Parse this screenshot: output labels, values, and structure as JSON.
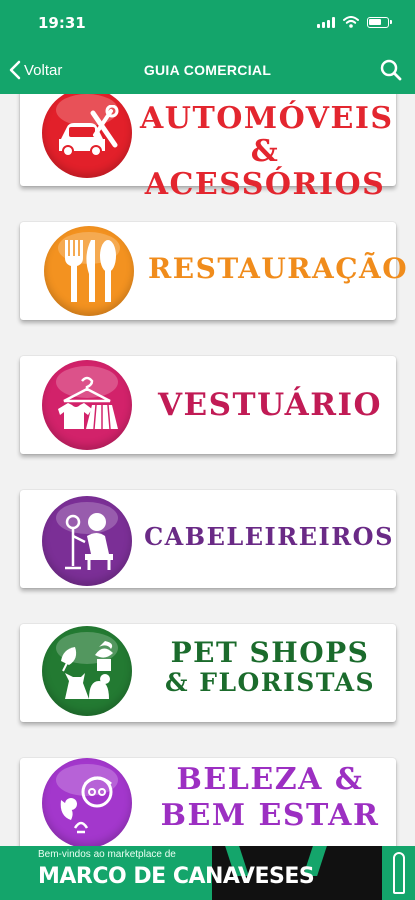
{
  "status_bar": {
    "time": "19:31"
  },
  "nav": {
    "back_label": "Voltar",
    "title": "GUIA COMERCIAL"
  },
  "categories": [
    {
      "line1": "AUTOMÓVEIS",
      "line2": "& ACESSÓRIOS",
      "color": "#e3262f",
      "circle": "#e2202a",
      "icon": "car-tools-icon"
    },
    {
      "line1": "RESTAURAÇÃO",
      "line2": "",
      "color": "#f08c1c",
      "circle": "#f39220",
      "icon": "cutlery-icon"
    },
    {
      "line1": "VESTUÁRIO",
      "line2": "",
      "color": "#c11b55",
      "circle": "#d2226a",
      "icon": "clothing-icon"
    },
    {
      "line1": "CABELEIREIROS",
      "line2": "",
      "color": "#6a2a86",
      "circle": "#7b2f96",
      "icon": "hair-salon-icon"
    },
    {
      "line1": "PET SHOPS",
      "line2": "& FLORISTAS",
      "color": "#1b6b2c",
      "circle": "#237a32",
      "icon": "pet-plant-icon"
    },
    {
      "line1": "BELEZA &",
      "line2": "BEM ESTAR",
      "color": "#9c2fc2",
      "circle": "#a337cc",
      "icon": "beauty-icon"
    }
  ],
  "banner": {
    "tagline": "Bem-vindos ao marketplace de",
    "city": "MARCO DE CANAVESES"
  }
}
